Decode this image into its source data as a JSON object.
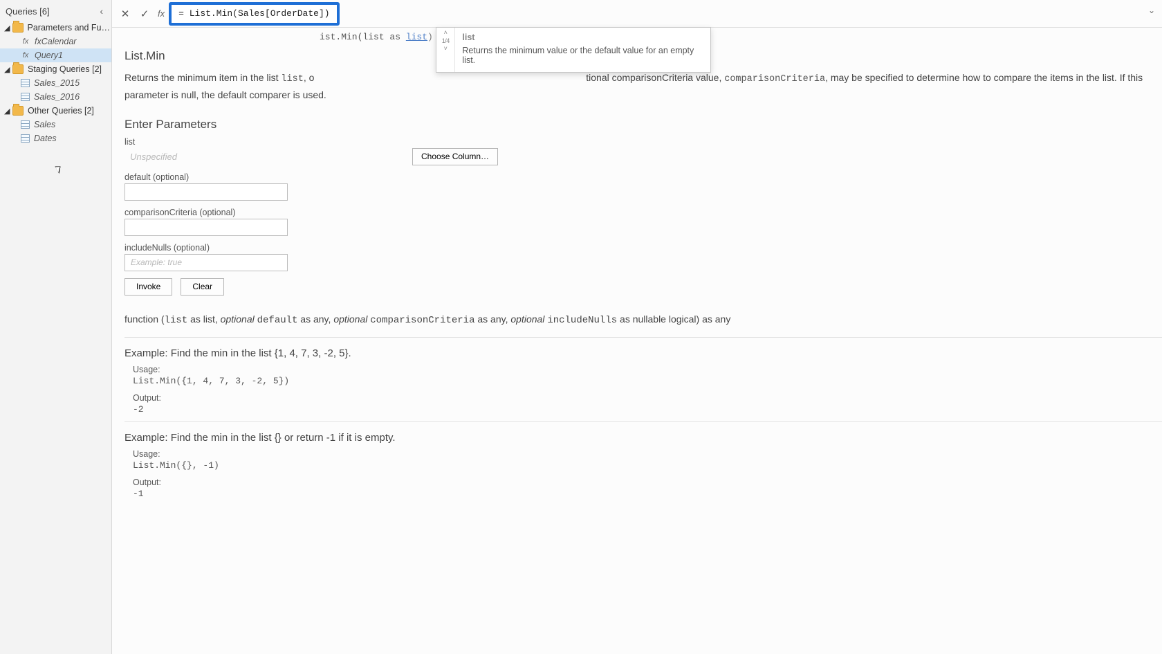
{
  "queriesPane": {
    "header": "Queries [6]",
    "groups": [
      {
        "label": "Parameters and Fu…",
        "items": [
          {
            "icon": "fx",
            "label": "fxCalendar",
            "selected": false
          },
          {
            "icon": "fx",
            "label": "Query1",
            "selected": true
          }
        ]
      },
      {
        "label": "Staging Queries [2]",
        "items": [
          {
            "icon": "table",
            "label": "Sales_2015"
          },
          {
            "icon": "table",
            "label": "Sales_2016"
          }
        ]
      },
      {
        "label": "Other Queries [2]",
        "items": [
          {
            "icon": "table",
            "label": "Sales"
          },
          {
            "icon": "table",
            "label": "Dates"
          }
        ]
      }
    ]
  },
  "formulaBar": {
    "formula": "= List.Min(Sales[OrderDate])"
  },
  "intellisense": {
    "title": "list",
    "counter": "1/4",
    "desc": "Returns the minimum value or the default value for an empty list."
  },
  "signatureTop": {
    "prefix": "ist.Min(list as ",
    "linkText": "list",
    "suffix": ")"
  },
  "functionTitle": "List.Min",
  "description": {
    "pre": "Returns the minimum item in the list ",
    "code1": "list",
    "mid": ", o",
    "tail1": "tional comparisonCriteria value, ",
    "code2": "comparisonCriteria",
    "tail2": ", may be specified to determine how to compare the items in the list. If this parameter is null, the default comparer is used."
  },
  "parametersTitle": "Enter Parameters",
  "params": {
    "p1Label": "list",
    "p1Placeholder": "Unspecified",
    "chooseCol": "Choose Column…",
    "p2Label": "default (optional)",
    "p3Label": "comparisonCriteria (optional)",
    "p4Label": "includeNulls (optional)",
    "p4Placeholder": "Example: true",
    "invoke": "Invoke",
    "clear": "Clear"
  },
  "fnSignature": {
    "text": "function (list as list, optional default as any, optional comparisonCriteria as any, optional includeNulls as nullable logical) as any"
  },
  "examples": [
    {
      "title": "Example: Find the min in the list {1, 4, 7, 3, -2, 5}.",
      "usageLabel": "Usage:",
      "usageCode": "List.Min({1, 4, 7, 3, -2, 5})",
      "outputLabel": "Output:",
      "outputCode": "-2"
    },
    {
      "title": "Example: Find the min in the list {} or return -1 if it is empty.",
      "usageLabel": "Usage:",
      "usageCode": "List.Min({}, -1)",
      "outputLabel": "Output:",
      "outputCode": "-1"
    }
  ]
}
